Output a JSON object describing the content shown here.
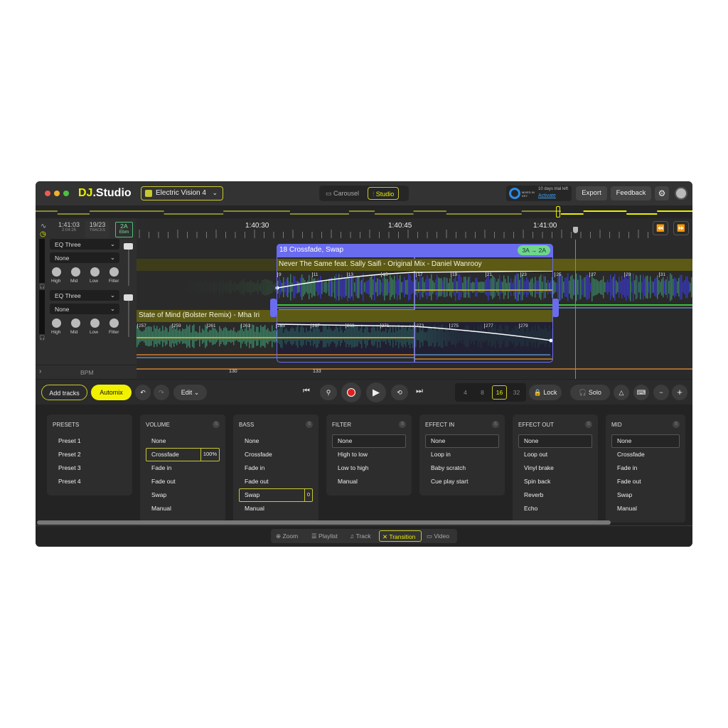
{
  "app": {
    "logo": "DJ.Studio",
    "project": "Electric Vision 4"
  },
  "view_toggle": [
    {
      "label": "Carousel",
      "icon": "video-icon",
      "active": false
    },
    {
      "label": "Studio",
      "icon": "waveform-icon",
      "active": true
    }
  ],
  "trial": {
    "brand": "MIXED IN KEY",
    "text": "10 days trial left",
    "link": "Activate"
  },
  "header_buttons": {
    "export": "Export",
    "feedback": "Feedback"
  },
  "info": {
    "time": "1:41:03",
    "total": "2:04:26",
    "tracks": "19/23",
    "tracks_label": "TRACKS",
    "key": "2A",
    "key_name": "Ebm"
  },
  "ruler": {
    "labels": [
      "1:40:30",
      "1:40:45",
      "1:41:00"
    ]
  },
  "channels": [
    {
      "eq": "EQ Three",
      "fx": "None",
      "knobs": [
        "High",
        "Mid",
        "Low",
        "Filter"
      ]
    },
    {
      "eq": "EQ Three",
      "fx": "None",
      "knobs": [
        "High",
        "Mid",
        "Low",
        "Filter"
      ]
    }
  ],
  "bpm": {
    "label": "BPM",
    "values": [
      "130",
      "133"
    ]
  },
  "transition": {
    "title": "18 Crossfade, Swap",
    "key_change": "3A → 2A"
  },
  "tracks": [
    {
      "title": "Never The Same feat. Sally Saifi - Original Mix - Daniel Wanrooy",
      "beats": [
        "9",
        "11",
        "13",
        "15",
        "17",
        "19",
        "21",
        "23",
        "25",
        "27",
        "29",
        "31"
      ]
    },
    {
      "title": "State of Mind (Bolster Remix) - Mha Iri",
      "beats": [
        "257",
        "259",
        "261",
        "263",
        "265",
        "267",
        "269",
        "271",
        "273",
        "275",
        "277",
        "279"
      ]
    }
  ],
  "toolbar": {
    "add_tracks": "Add tracks",
    "automix": "Automix",
    "edit": "Edit",
    "bars": [
      "4",
      "8",
      "16",
      "32"
    ],
    "bars_selected": "16",
    "lock": "Lock",
    "solo": "Solo"
  },
  "panels": [
    {
      "title": "PRESETS",
      "items": [
        "Preset 1",
        "Preset 2",
        "Preset 3",
        "Preset 4"
      ]
    },
    {
      "title": "VOLUME",
      "items": [
        "None",
        "Crossfade",
        "Fade in",
        "Fade out",
        "Swap",
        "Manual"
      ],
      "selected": "Crossfade",
      "value": "100%"
    },
    {
      "title": "BASS",
      "items": [
        "None",
        "Crossfade",
        "Fade in",
        "Fade out",
        "Swap",
        "Manual"
      ],
      "selected": "Swap",
      "value": "0"
    },
    {
      "title": "FILTER",
      "items": [
        "None",
        "High to low",
        "Low to high",
        "Manual"
      ],
      "selected": "None"
    },
    {
      "title": "EFFECT IN",
      "items": [
        "None",
        "Loop in",
        "Baby scratch",
        "Cue play start"
      ],
      "selected": "None"
    },
    {
      "title": "EFFECT OUT",
      "items": [
        "None",
        "Loop out",
        "Vinyl brake",
        "Spin back",
        "Reverb",
        "Echo"
      ],
      "selected": "None"
    },
    {
      "title": "MID",
      "items": [
        "None",
        "Crossfade",
        "Fade in",
        "Fade out",
        "Swap",
        "Manual"
      ],
      "selected": "None"
    }
  ],
  "bottom_tabs": [
    {
      "label": "Zoom",
      "icon": "zoom-icon"
    },
    {
      "label": "Playlist",
      "icon": "playlist-icon"
    },
    {
      "label": "Track",
      "icon": "music-note-icon"
    },
    {
      "label": "Transition",
      "icon": "transition-icon",
      "active": true
    },
    {
      "label": "Video",
      "icon": "video-icon"
    }
  ],
  "colors": {
    "accent": "#e8f000",
    "transition": "#6a6cf0",
    "key_badge": "#6fd68a",
    "record": "#e02020"
  }
}
